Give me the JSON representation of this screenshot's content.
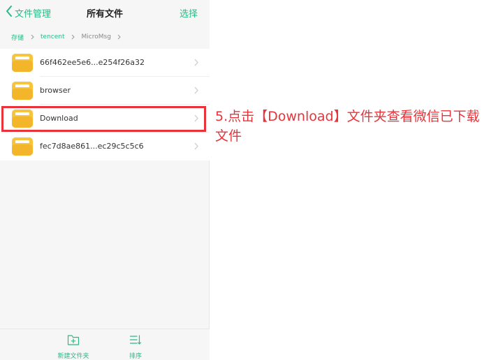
{
  "header": {
    "back_label": "文件管理",
    "title": "所有文件",
    "select_label": "选择"
  },
  "breadcrumb": [
    {
      "label": "存储"
    },
    {
      "label": "tencent"
    },
    {
      "label": "MicroMsg"
    }
  ],
  "files": [
    {
      "name": "66f462ee5e6...e254f26a32",
      "icon": "folder-icon"
    },
    {
      "name": "browser",
      "icon": "folder-icon"
    },
    {
      "name": "Download",
      "icon": "folder-icon"
    },
    {
      "name": "fec7d8ae861...ec29c5c5c6",
      "icon": "folder-icon"
    }
  ],
  "bottom_bar": {
    "new_folder_label": "新建文件夹",
    "sort_label": "排序"
  },
  "annotation": {
    "text": "5.点击【Download】文件夹查看微信已下载文件"
  },
  "colors": {
    "accent": "#2eb886",
    "highlight": "#e8333a",
    "folder": "#f8c33f"
  }
}
